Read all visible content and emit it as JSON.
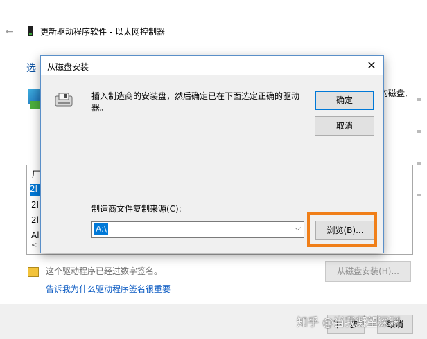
{
  "background": {
    "back_icon": "back-arrow-icon",
    "window_title": "更新驱动程序软件 - 以太网控制器",
    "heading": "选",
    "right_text": "的磁盘,",
    "list_header": "厂",
    "list_items": [
      "2l",
      "2l",
      "2l",
      "Al"
    ],
    "scroll_left": "<",
    "signed_text": "这个驱动程序已经过数字签名。",
    "signing_link": "告诉我为什么驱动程序签名很重要",
    "have_disk_button": "从磁盘安装(H)...",
    "next_button": "下一步",
    "cancel_button": "取消"
  },
  "dialog": {
    "title": "从磁盘安装",
    "close_label": "✕",
    "message": "插入制造商的安装盘，然后确定已在下面选定正确的驱动器。",
    "ok_button": "确定",
    "cancel_button": "取消",
    "source_label": "制造商文件复制来源(C):",
    "source_value": "A:\\",
    "dropdown_arrow": "⌵",
    "browse_button": "浏览(B)...",
    "highlight_color": "#f07f19"
  },
  "watermark": "知乎 @当我凝望深渊"
}
